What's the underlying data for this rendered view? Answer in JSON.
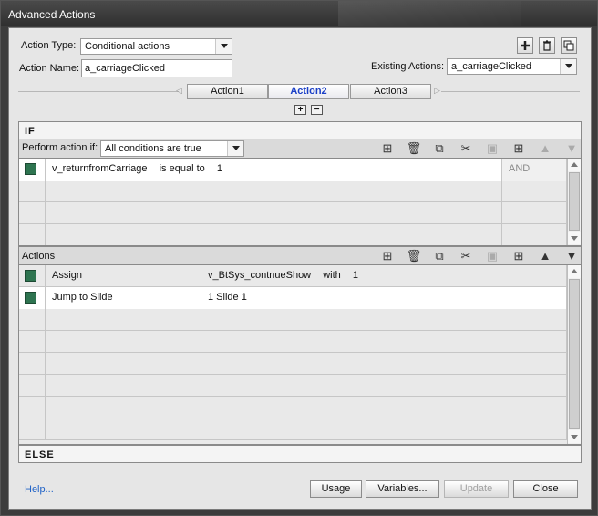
{
  "window": {
    "title": "Advanced Actions"
  },
  "header": {
    "action_type_label": "Action Type:",
    "action_type_value": "Conditional actions",
    "action_name_label": "Action Name:",
    "action_name_value": "a_carriageClicked",
    "existing_actions_label": "Existing Actions:",
    "existing_actions_value": "a_carriageClicked"
  },
  "tabs": [
    {
      "label": "Action1"
    },
    {
      "label": "Action2"
    },
    {
      "label": "Action3"
    }
  ],
  "if_section": {
    "heading": "IF",
    "perform_label": "Perform action if:",
    "perform_value": "All conditions are true",
    "rows": [
      {
        "variable": "v_returnfromCarriage",
        "operator": "is equal to",
        "value": "1",
        "logic": "AND"
      }
    ]
  },
  "actions_section": {
    "heading": "Actions",
    "rows": [
      {
        "action": "Assign",
        "target": "v_BtSys_contnueShow",
        "with": "with",
        "value": "1"
      },
      {
        "action": "Jump to Slide",
        "target": "1 Slide 1"
      }
    ]
  },
  "else_label": "ELSE",
  "footer": {
    "help": "Help...",
    "usage": "Usage",
    "variables": "Variables...",
    "update": "Update",
    "close": "Close"
  },
  "colors": {
    "condition_swatch": "#2e7450",
    "active_tab": "#1a3fc7",
    "link": "#1f62c7"
  }
}
